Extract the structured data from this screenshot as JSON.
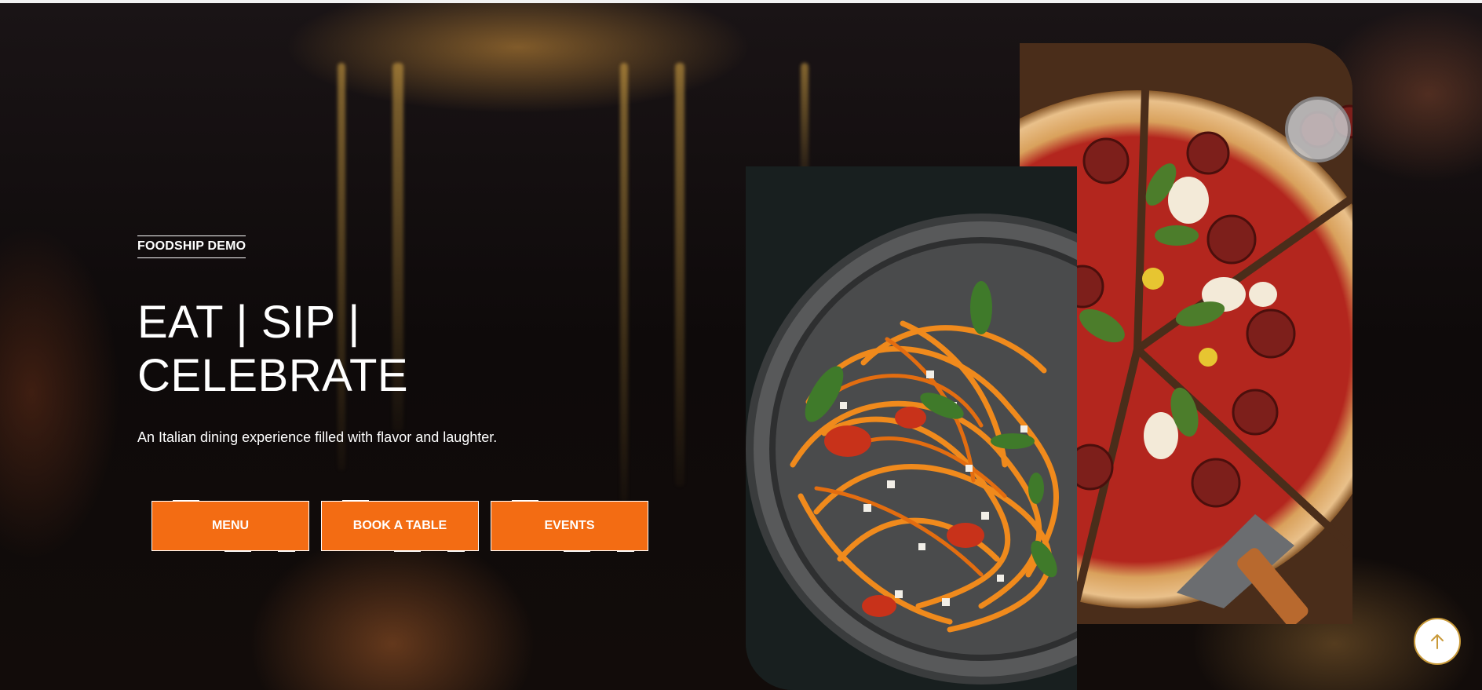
{
  "hero": {
    "eyebrow": "FOODSHIP DEMO",
    "headline": "EAT | SIP | CELEBRATE",
    "subline": "An Italian dining experience filled with flavor and laughter."
  },
  "buttons": {
    "menu": "MENU",
    "book": "BOOK A TABLE",
    "events": "EVENTS"
  },
  "images": {
    "left": "spaghetti-pasta-bowl",
    "right": "pepperoni-pizza-board"
  },
  "icons": {
    "scroll_top": "arrow-up-icon"
  },
  "colors": {
    "accent": "#f36c13",
    "scroll_ring": "#c99a3a"
  }
}
